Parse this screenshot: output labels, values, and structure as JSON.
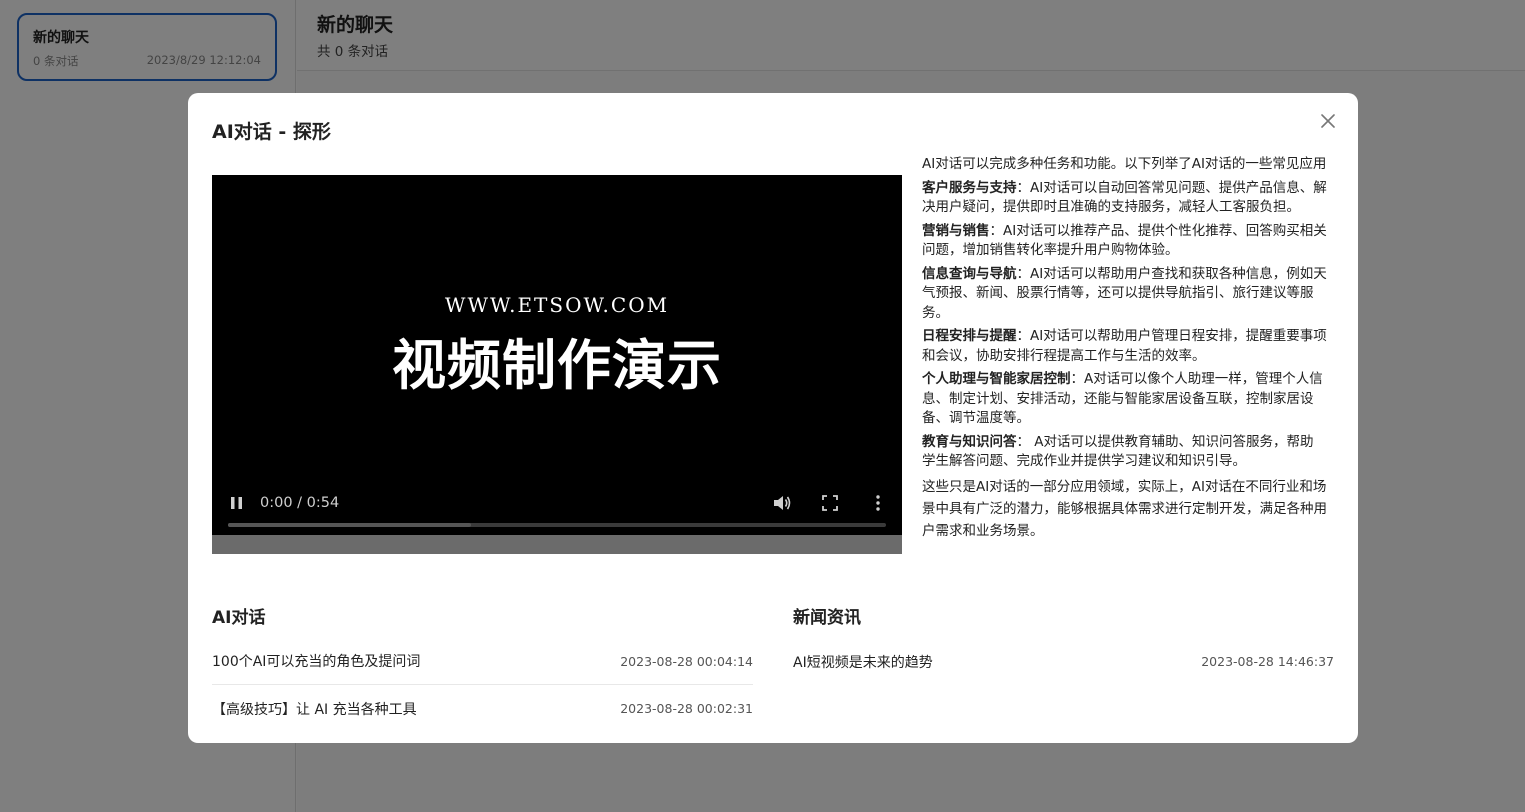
{
  "sidebar": {
    "session": {
      "title": "新的聊天",
      "count": "0 条对话",
      "time": "2023/8/29 12:12:04"
    }
  },
  "main": {
    "title": "新的聊天",
    "subtitle": "共 0 条对话"
  },
  "modal": {
    "title": "AI对话 - 探形",
    "video": {
      "watermark": "WWW.ETSOW.COM",
      "caption": "视频制作演示",
      "time": "0:00 / 0:54",
      "buffered": 0.37
    },
    "description": {
      "intro": "AI对话可以完成多种任务和功能。以下列举了AI对话的一些常见应用",
      "items": [
        {
          "label": "客户服务与支持",
          "text": "：AI对话可以自动回答常见问题、提供产品信息、解决用户疑问，提供即时且准确的支持服务，减轻人工客服负担。"
        },
        {
          "label": "营销与销售",
          "text": "：AI对话可以推荐产品、提供个性化推荐、回答购买相关问题，增加销售转化率提升用户购物体验。"
        },
        {
          "label": "信息查询与导航",
          "text": "：AI对话可以帮助用户查找和获取各种信息，例如天气预报、新闻、股票行情等，还可以提供导航指引、旅行建议等服务。"
        },
        {
          "label": "日程安排与提醒",
          "text": "：AI对话可以帮助用户管理日程安排，提醒重要事项和会议，协助安排行程提高工作与生活的效率。"
        },
        {
          "label": "个人助理与智能家居控制",
          "text": "：A对话可以像个人助理一样，管理个人信息、制定计划、安排活动，还能与智能家居设备互联，控制家居设备、调节温度等。"
        },
        {
          "label": "教育与知识问答",
          "text": "： A对话可以提供教育辅助、知识问答服务，帮助学生解答问题、完成作业并提供学习建议和知识引导。"
        }
      ],
      "outro": "这些只是AI对话的一部分应用领域，实际上，AI对话在不同行业和场景中具有广泛的潜力，能够根据具体需求进行定制开发，满足各种用户需求和业务场景。"
    },
    "lists": {
      "left": {
        "title": "AI对话",
        "items": [
          {
            "title": "100个AI可以充当的角色及提问词",
            "date": "2023-08-28 00:04:14"
          },
          {
            "title": "【高级技巧】让 AI 充当各种工具",
            "date": "2023-08-28 00:02:31"
          }
        ]
      },
      "right": {
        "title": "新闻资讯",
        "items": [
          {
            "title": "AI短视频是未来的趋势",
            "date": "2023-08-28 14:46:37"
          }
        ]
      }
    }
  }
}
